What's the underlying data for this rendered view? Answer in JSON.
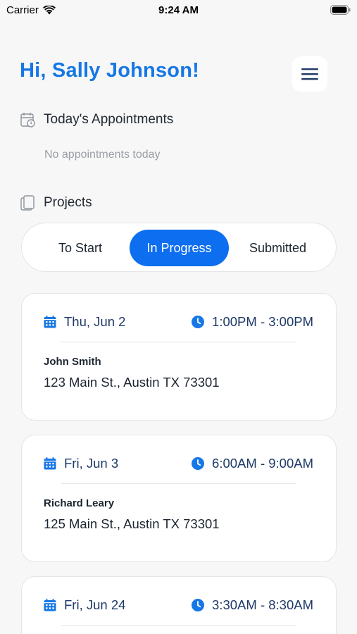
{
  "status_bar": {
    "carrier": "Carrier",
    "time": "9:24 AM"
  },
  "header": {
    "greeting": "Hi, Sally Johnson!",
    "menu_icon": "hamburger-menu-icon"
  },
  "appointments": {
    "heading": "Today's Appointments",
    "icon": "calendar-clock-icon",
    "empty_text": "No appointments today"
  },
  "projects": {
    "heading": "Projects",
    "icon": "documents-icon",
    "tabs": [
      {
        "label": "To Start",
        "active": false
      },
      {
        "label": "In Progress",
        "active": true
      },
      {
        "label": "Submitted",
        "active": false
      }
    ],
    "cards": [
      {
        "date": "Thu, Jun 2",
        "time": "1:00PM - 3:00PM",
        "name": "John Smith",
        "address": "123 Main St., Austin TX 73301"
      },
      {
        "date": "Fri, Jun 3",
        "time": "6:00AM - 9:00AM",
        "name": "Richard Leary",
        "address": "125 Main St., Austin TX 73301"
      },
      {
        "date": "Fri, Jun 24",
        "time": "3:30AM - 8:30AM",
        "name": "",
        "address": ""
      }
    ]
  },
  "colors": {
    "accent": "#1677e6",
    "active_tab": "#0d6ef0",
    "date_text": "#1f3a68",
    "background": "#f7f7f7"
  }
}
